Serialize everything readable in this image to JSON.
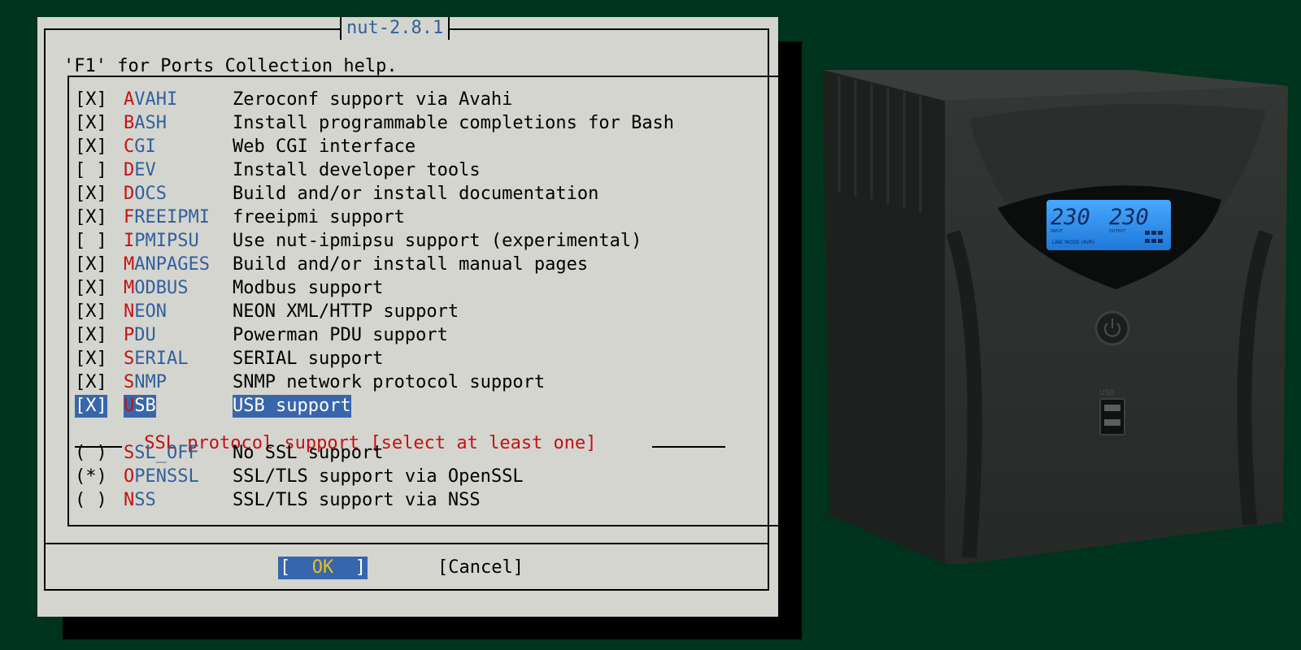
{
  "dialog": {
    "title": "nut-2.8.1",
    "help_text": "'F1' for Ports Collection help.",
    "options": [
      {
        "sel": "[X]",
        "hot": "A",
        "rest": "VAHI",
        "desc": "Zeroconf support via Avahi"
      },
      {
        "sel": "[X]",
        "hot": "B",
        "rest": "ASH",
        "desc": "Install programmable completions for Bash"
      },
      {
        "sel": "[X]",
        "hot": "C",
        "rest": "GI",
        "desc": "Web CGI interface"
      },
      {
        "sel": "[ ]",
        "hot": "D",
        "rest": "EV",
        "desc": "Install developer tools"
      },
      {
        "sel": "[X]",
        "hot": "D",
        "rest": "OCS",
        "desc": "Build and/or install documentation"
      },
      {
        "sel": "[X]",
        "hot": "F",
        "rest": "REEIPMI",
        "desc": "freeipmi support"
      },
      {
        "sel": "[ ]",
        "hot": "I",
        "rest": "PMIPSU",
        "desc": "Use nut-ipmipsu support (experimental)"
      },
      {
        "sel": "[X]",
        "hot": "M",
        "rest": "ANPAGES",
        "desc": "Build and/or install manual pages"
      },
      {
        "sel": "[X]",
        "hot": "M",
        "rest": "ODBUS",
        "desc": "Modbus support"
      },
      {
        "sel": "[X]",
        "hot": "N",
        "rest": "EON",
        "desc": "NEON XML/HTTP support"
      },
      {
        "sel": "[X]",
        "hot": "P",
        "rest": "DU",
        "desc": "Powerman PDU support"
      },
      {
        "sel": "[X]",
        "hot": "S",
        "rest": "ERIAL",
        "desc": "SERIAL support"
      },
      {
        "sel": "[X]",
        "hot": "S",
        "rest": "NMP",
        "desc": "SNMP network protocol support"
      },
      {
        "sel": "[X]",
        "hot": "U",
        "rest": "SB",
        "desc": "USB support"
      }
    ],
    "ssl_group_label": " SSL protocol support [select at least one] ",
    "ssl_options": [
      {
        "sel": "( )",
        "hot": "S",
        "rest": "SL_OFF",
        "desc": "No SSL support"
      },
      {
        "sel": "(*)",
        "hot": "O",
        "rest": "PENSSL",
        "desc": "SSL/TLS support via OpenSSL"
      },
      {
        "sel": "( )",
        "hot": "N",
        "rest": "SS",
        "desc": "SSL/TLS support via NSS"
      }
    ],
    "ok_left": "[  ",
    "ok_label": "OK",
    "ok_right": "  ]",
    "cancel_label": "[Cancel]"
  },
  "ups_display": {
    "input": "230",
    "output": "230",
    "small_labels": [
      "INPUT",
      "OUTPUT",
      "LINE MODE  (AVR)"
    ],
    "usb_label": "USB"
  },
  "colors": {
    "desktop_bg": "#00331d",
    "dialog_bg": "#d4d5ce",
    "highlight": "#3866ac",
    "hotkey": "#c81010",
    "option_name": "#3060a0",
    "lcd": "#2f8fe8"
  }
}
